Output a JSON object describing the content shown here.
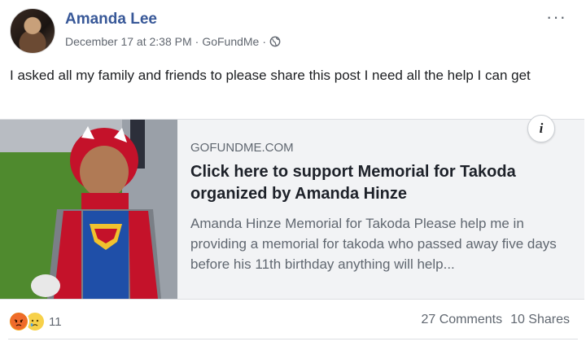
{
  "post": {
    "author": "Amanda Lee",
    "date": "December 17 at 2:38 PM",
    "separator": "·",
    "source": "GoFundMe",
    "privacy_icon": "globe-icon",
    "more_icon": "more-options-icon",
    "more_label": "···",
    "text": "I asked all my family and friends to please share this post I need all the help I can get"
  },
  "link_card": {
    "domain": "GOFUNDME.COM",
    "title": "Click here to support Memorial for Takoda organized by Amanda Hinze",
    "description": "Amanda Hinze Memorial for Takoda Please help me in providing a memorial for takoda who passed away five days before his 11th birthday anything will help...",
    "info_label": "i",
    "image_icon": "photo-boy-in-costume"
  },
  "footer": {
    "reaction_icons": [
      "angry-reaction-icon",
      "sad-reaction-icon"
    ],
    "reaction_count": "11",
    "comments": "27 Comments",
    "shares": "10 Shares"
  },
  "colors": {
    "author_link": "#385898",
    "meta_text": "#616770",
    "card_bg": "#f2f3f5"
  }
}
